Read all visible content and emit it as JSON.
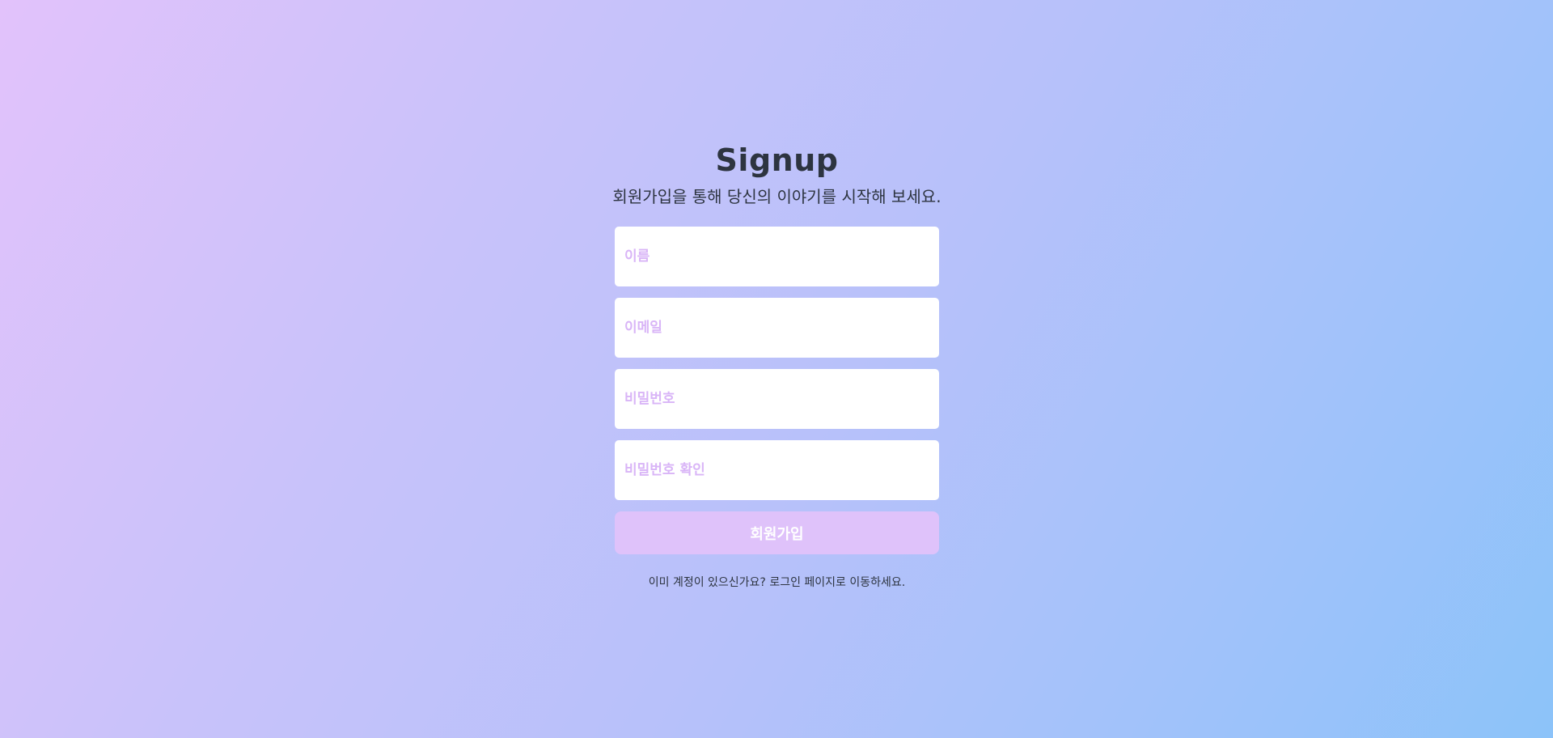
{
  "header": {
    "title": "Signup",
    "subtitle": "회원가입을 통해 당신의 이야기를 시작해 보세요."
  },
  "form": {
    "name_placeholder": "이름",
    "email_placeholder": "이메일",
    "password_placeholder": "비밀번호",
    "password_confirm_placeholder": "비밀번호 확인",
    "submit_label": "회원가입"
  },
  "footer": {
    "login_prompt": "이미 계정이 있으신가요?",
    "login_link": "로그인 페이지로 이동하세요."
  },
  "colors": {
    "background_start": "#e2c2fb",
    "background_end": "#8cc3f9",
    "text": "#2d3440",
    "placeholder": "#d9b5f7",
    "button": "#dfc2fa"
  }
}
